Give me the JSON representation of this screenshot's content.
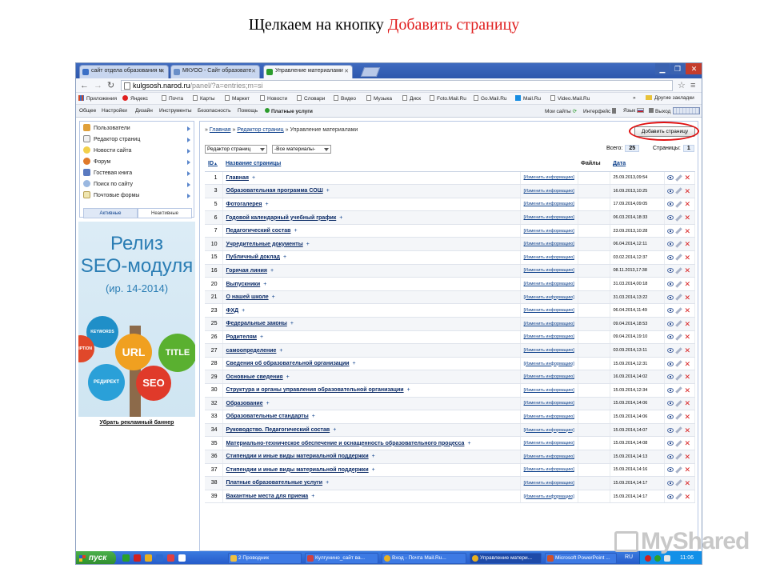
{
  "caption": {
    "prefix": "Щелкаем на кнопку ",
    "highlight": "Добавить страницу"
  },
  "browser": {
    "tabs": [
      {
        "title": "сайт отдела образования м",
        "favicon_color": "#3a6fc6"
      },
      {
        "title": "МКУОО - Сайт образовате",
        "favicon_color": "#6a8fc8"
      },
      {
        "title": "Управление материалами",
        "favicon_color": "#2c9c2c"
      }
    ],
    "url": {
      "host": "kulgsosh.narod.ru",
      "path": "/panel/?a=entries;m=si"
    },
    "bookmarks": [
      "Приложения",
      "Яндекс",
      "Почта",
      "Карты",
      "Маркет",
      "Новости",
      "Словари",
      "Видео",
      "Музыка",
      "Диск",
      "Foto.Mail.Ru",
      "Go.Mail.Ru",
      "Mail.Ru",
      "Video.Mail.Ru"
    ],
    "bookmarks_more": "»",
    "other_bookmarks": "Другие закладки"
  },
  "adminbar": {
    "left": [
      "Общее",
      "Настройки",
      "Дизайн",
      "Инструменты",
      "Безопасность",
      "Помощь"
    ],
    "paid": "Платные услуги",
    "right": [
      "Мои сайты",
      "Интерфейс",
      "Язык",
      "Выход"
    ]
  },
  "sidebar": {
    "items": [
      {
        "label": "Пользователи",
        "icon": "users-icon"
      },
      {
        "label": "Редактор страниц",
        "icon": "pages-icon"
      },
      {
        "label": "Новости сайта",
        "icon": "news-icon"
      },
      {
        "label": "Форум",
        "icon": "forum-icon"
      },
      {
        "label": "Гостевая книга",
        "icon": "guestbook-icon"
      },
      {
        "label": "Поиск по сайту",
        "icon": "search-icon"
      },
      {
        "label": "Почтовые формы",
        "icon": "mail-form-icon"
      }
    ],
    "tab_active": "Активные",
    "tab_inactive": "Неактивные"
  },
  "banner": {
    "line1": "Релиз",
    "line2": "SEO-модуля",
    "line3": "(ир. 14-2014)",
    "bubbles": [
      "KEYWORDS",
      "URL",
      "TITLE",
      "RIPTION",
      "РЕДИРЕКТ",
      "SEO"
    ],
    "remove_link": "Убрать рекламный баннер"
  },
  "main": {
    "breadcrumb": {
      "prefix": "»",
      "home": "Главная",
      "sep1": "»",
      "editor": "Редактор страниц",
      "sep2": "»",
      "current": "Управление материалами"
    },
    "add_button": "Добавить страницу",
    "filter_editor": "Редактор страниц",
    "filter_materials": "-Все материалы-",
    "total_label": "Всего:",
    "total_value": "25",
    "pages_label": "Страницы:",
    "pages_value": "1",
    "columns": {
      "id": "ID",
      "title": "Название страницы",
      "files": "Файлы",
      "date": "Дата"
    },
    "change_label": "[Изменить информацию]",
    "rows": [
      {
        "id": "1",
        "title": "Главная",
        "date": "25.09.2013,09:54"
      },
      {
        "id": "3",
        "title": "Образовательная программа СОШ",
        "date": "16.09.2013,10:25"
      },
      {
        "id": "5",
        "title": "Фотогалерея",
        "date": "17.09.2014,09:05"
      },
      {
        "id": "6",
        "title": "Годовой календарный учебный график",
        "date": "06.03.2014,18:33"
      },
      {
        "id": "7",
        "title": "Педагогический состав",
        "date": "23.09.2013,10:28"
      },
      {
        "id": "10",
        "title": "Учредительные документы",
        "date": "06.04.2014,12:11"
      },
      {
        "id": "15",
        "title": "Публичный доклад",
        "date": "03.02.2014,12:37"
      },
      {
        "id": "16",
        "title": "Горячая линия",
        "date": "08.11.2013,17:38"
      },
      {
        "id": "20",
        "title": "Выпускники",
        "date": "31.03.2014,00:18"
      },
      {
        "id": "21",
        "title": "О нашей школе",
        "date": "31.03.2014,13:22"
      },
      {
        "id": "23",
        "title": "ФХД",
        "date": "06.04.2014,11:49"
      },
      {
        "id": "25",
        "title": "Федеральные законы",
        "date": "09.04.2014,18:53"
      },
      {
        "id": "26",
        "title": "Родителям",
        "date": "09.04.2014,19:10"
      },
      {
        "id": "27",
        "title": "самоопределение",
        "date": "03.09.2014,13:11"
      },
      {
        "id": "28",
        "title": "Сведения об образовательной организации",
        "date": "15.09.2014,12:31"
      },
      {
        "id": "29",
        "title": "Основные сведения",
        "date": "16.09.2014,14:02"
      },
      {
        "id": "30",
        "title": "Структура и органы управления образовательной организации",
        "date": "15.09.2014,12:34"
      },
      {
        "id": "32",
        "title": "Образование",
        "date": "15.09.2014,14:06"
      },
      {
        "id": "33",
        "title": "Образовательные стандарты",
        "date": "15.09.2014,14:06"
      },
      {
        "id": "34",
        "title": "Руководство. Педагогический состав",
        "date": "15.09.2014,14:07"
      },
      {
        "id": "35",
        "title": "Материально-техническое обеспечение и оснащенность образовательного процесса",
        "date": "15.09.2014,14:08"
      },
      {
        "id": "36",
        "title": "Стипендии и иные виды материальной поддержки",
        "date": "15.09.2014,14:13"
      },
      {
        "id": "37",
        "title": "Стипендии и иные виды материальной поддержки",
        "date": "15.09.2014,14:16"
      },
      {
        "id": "38",
        "title": "Платные образовательные услуги",
        "date": "15.09.2014,14:17"
      },
      {
        "id": "39",
        "title": "Вакантные места для приема",
        "date": "15.09.2014,14:17"
      }
    ]
  },
  "taskbar": {
    "start": "пуск",
    "items": [
      "2 Проводник",
      "Кулгунино_сайт ва...",
      "Вход - Почта Mail.Ru...",
      "Управление матери...",
      "Microsoft PowerPoint ..."
    ],
    "lang": "RU",
    "clock": "11:06"
  },
  "watermark": "MyShared"
}
